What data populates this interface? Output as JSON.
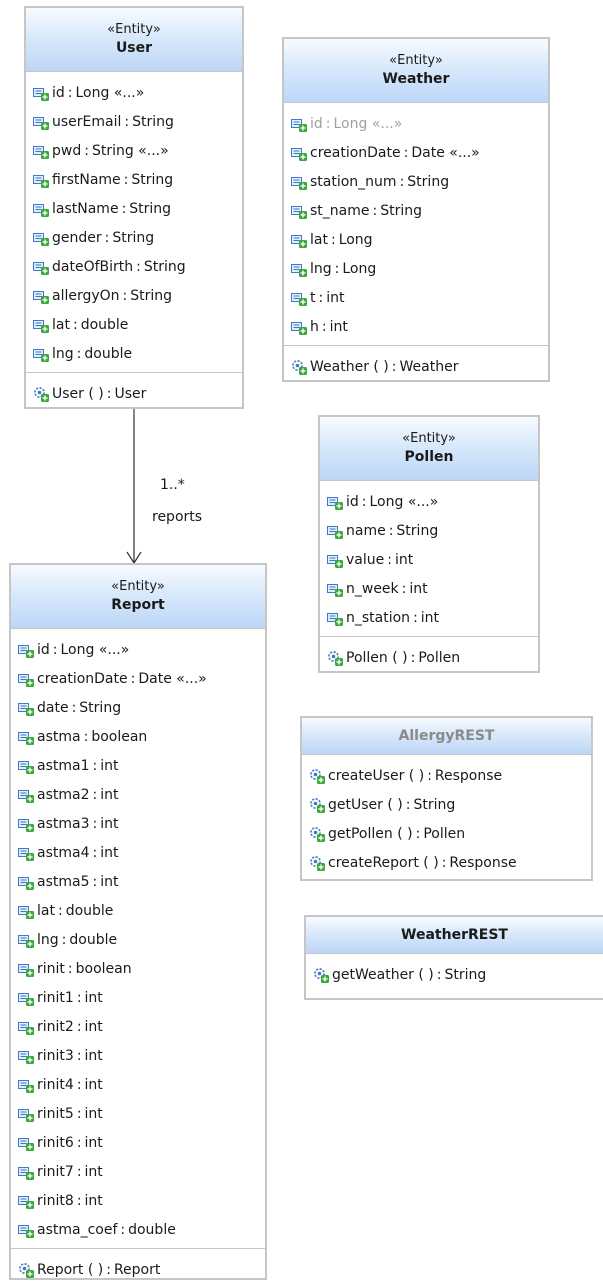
{
  "diagram": {
    "classes": {
      "user": {
        "stereotype": "«Entity»",
        "name": "User",
        "attributes": [
          {
            "name": "id",
            "type": "Long «...»"
          },
          {
            "name": "userEmail",
            "type": "String"
          },
          {
            "name": "pwd",
            "type": "String «...»"
          },
          {
            "name": "firstName",
            "type": "String"
          },
          {
            "name": "lastName",
            "type": "String"
          },
          {
            "name": "gender",
            "type": "String"
          },
          {
            "name": "dateOfBirth",
            "type": "String"
          },
          {
            "name": "allergyOn",
            "type": "String"
          },
          {
            "name": "lat",
            "type": "double"
          },
          {
            "name": "lng",
            "type": "double"
          }
        ],
        "operations": [
          {
            "name": "User ( )",
            "ret": "User"
          }
        ]
      },
      "weather": {
        "stereotype": "«Entity»",
        "name": "Weather",
        "attributes": [
          {
            "name": "id",
            "type": "Long «...»"
          },
          {
            "name": "creationDate",
            "type": "Date «...»"
          },
          {
            "name": "station_num",
            "type": "String"
          },
          {
            "name": "st_name",
            "type": "String"
          },
          {
            "name": "lat",
            "type": "Long"
          },
          {
            "name": "lng",
            "type": "Long"
          },
          {
            "name": "t",
            "type": "int"
          },
          {
            "name": "h",
            "type": "int"
          }
        ],
        "operations": [
          {
            "name": "Weather ( )",
            "ret": "Weather"
          }
        ]
      },
      "pollen": {
        "stereotype": "«Entity»",
        "name": "Pollen",
        "attributes": [
          {
            "name": "id",
            "type": "Long «...»"
          },
          {
            "name": "name",
            "type": "String"
          },
          {
            "name": "value",
            "type": "int"
          },
          {
            "name": "n_week",
            "type": "int"
          },
          {
            "name": "n_station",
            "type": "int"
          }
        ],
        "operations": [
          {
            "name": "Pollen ( )",
            "ret": "Pollen"
          }
        ]
      },
      "report": {
        "stereotype": "«Entity»",
        "name": "Report",
        "attributes": [
          {
            "name": "id",
            "type": "Long «...»"
          },
          {
            "name": "creationDate",
            "type": "Date «...»"
          },
          {
            "name": "date",
            "type": "String"
          },
          {
            "name": "astma",
            "type": "boolean"
          },
          {
            "name": "astma1",
            "type": "int"
          },
          {
            "name": "astma2",
            "type": "int"
          },
          {
            "name": "astma3",
            "type": "int"
          },
          {
            "name": "astma4",
            "type": "int"
          },
          {
            "name": "astma5",
            "type": "int"
          },
          {
            "name": "lat",
            "type": "double"
          },
          {
            "name": "lng",
            "type": "double"
          },
          {
            "name": "rinit",
            "type": "boolean"
          },
          {
            "name": "rinit1",
            "type": "int"
          },
          {
            "name": "rinit2",
            "type": "int"
          },
          {
            "name": "rinit3",
            "type": "int"
          },
          {
            "name": "rinit4",
            "type": "int"
          },
          {
            "name": "rinit5",
            "type": "int"
          },
          {
            "name": "rinit6",
            "type": "int"
          },
          {
            "name": "rinit7",
            "type": "int"
          },
          {
            "name": "rinit8",
            "type": "int"
          },
          {
            "name": "astma_coef",
            "type": "double"
          }
        ],
        "operations": [
          {
            "name": "Report ( )",
            "ret": "Report"
          }
        ]
      },
      "allergyrest": {
        "name": "AllergyREST",
        "operations": [
          {
            "name": "createUser ( )",
            "ret": "Response"
          },
          {
            "name": "getUser ( )",
            "ret": "String"
          },
          {
            "name": "getPollen ( )",
            "ret": "Pollen"
          },
          {
            "name": "createReport ( )",
            "ret": "Response"
          }
        ]
      },
      "weatherrest": {
        "name": "WeatherREST",
        "operations": [
          {
            "name": "getWeather ( )",
            "ret": "String"
          }
        ]
      }
    },
    "association": {
      "multiplicity": "1..*",
      "role": "reports"
    }
  }
}
